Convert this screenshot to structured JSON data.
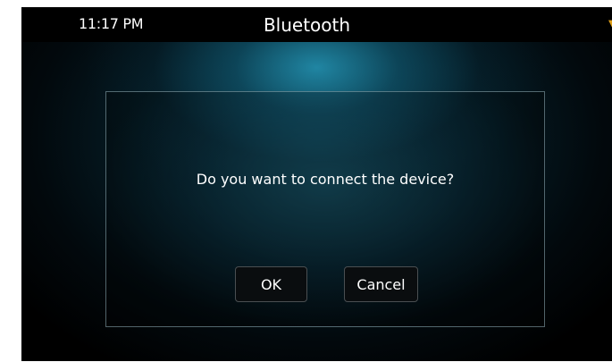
{
  "status_bar": {
    "time": "11:17 PM",
    "title": "Bluetooth"
  },
  "dialog": {
    "message": "Do you want to connect the device?",
    "ok_label": "OK",
    "cancel_label": "Cancel"
  },
  "colors": {
    "background": "#000000",
    "accent_glow": "#1e9bbd",
    "dialog_border": "#96b4be",
    "button_border": "#4a4f52"
  },
  "icons": {
    "edge": "status-indicator-icon"
  }
}
